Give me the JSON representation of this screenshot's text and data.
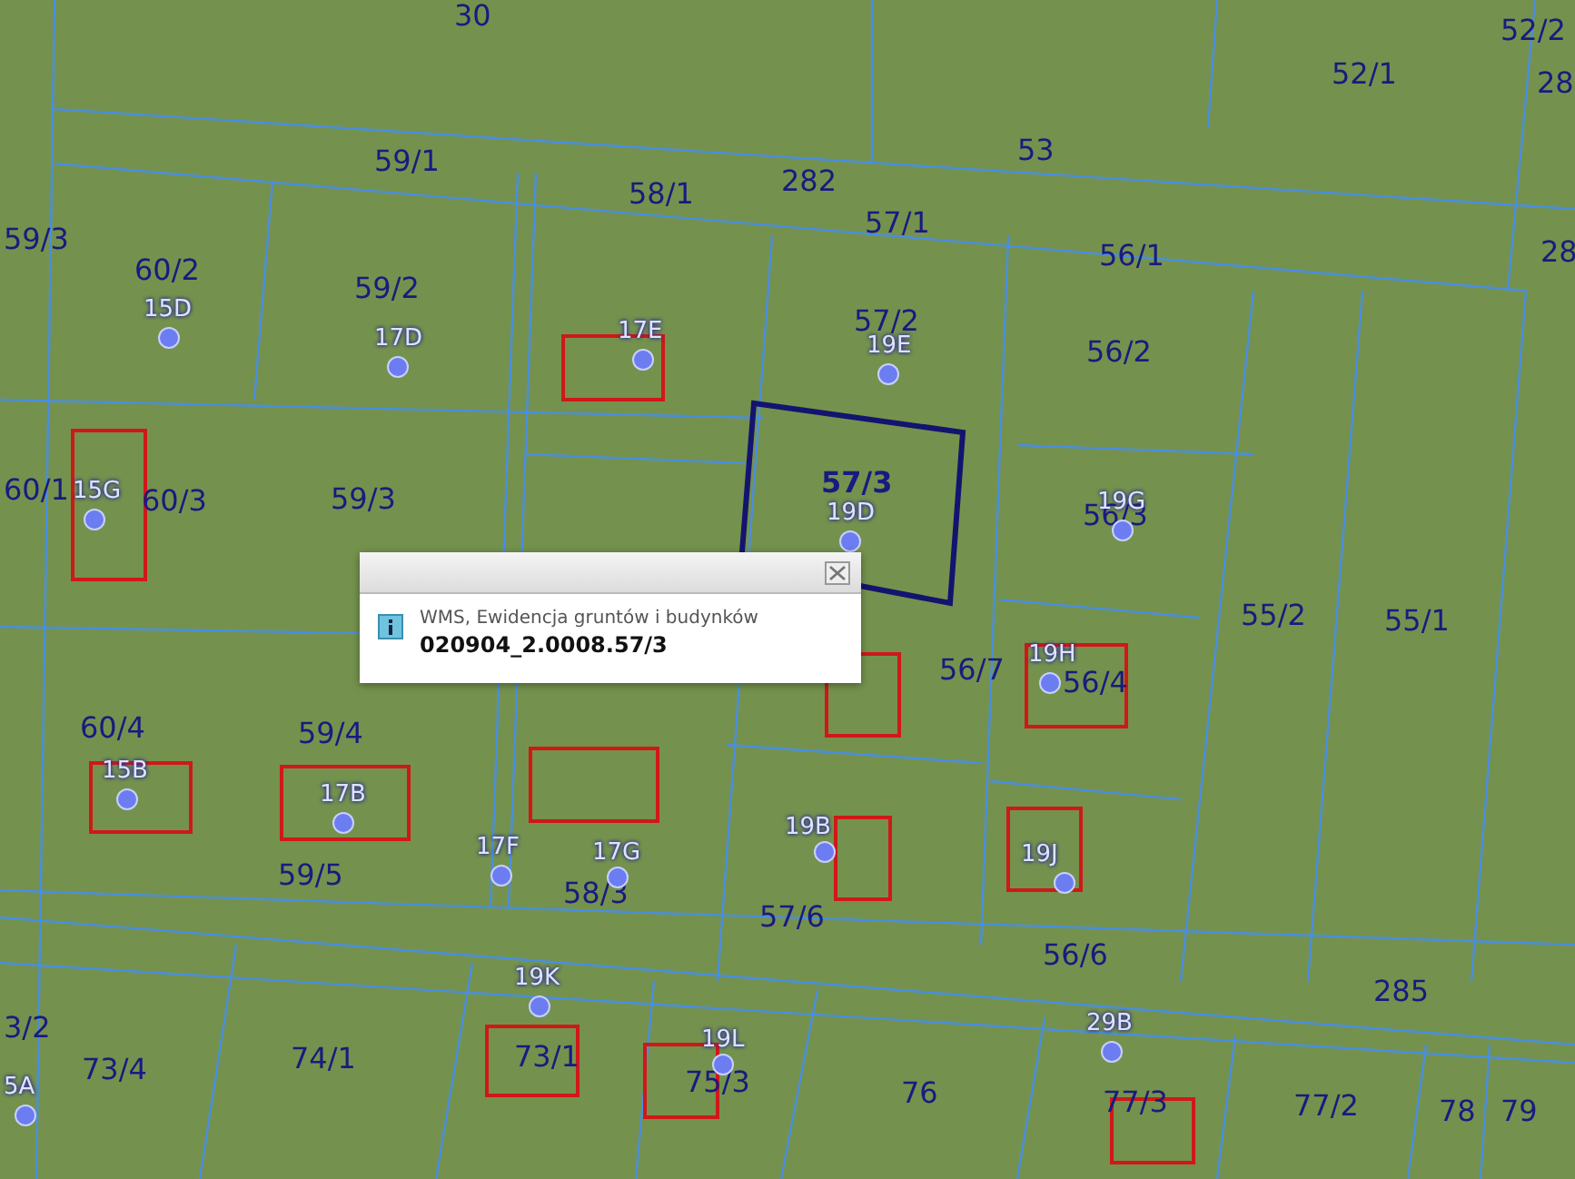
{
  "parcels": [
    {
      "label": "30",
      "selected": false
    },
    {
      "label": "52/2",
      "selected": false
    },
    {
      "label": "52/1",
      "selected": false
    },
    {
      "label": "28",
      "selected": false
    },
    {
      "label": "53",
      "selected": false
    },
    {
      "label": "59/1",
      "selected": false
    },
    {
      "label": "58/1",
      "selected": false
    },
    {
      "label": "282",
      "selected": false
    },
    {
      "label": "57/1",
      "selected": false
    },
    {
      "label": "56/1",
      "selected": false
    },
    {
      "label": "28",
      "selected": false
    },
    {
      "label": "59/3",
      "selected": false
    },
    {
      "label": "60/2",
      "selected": false
    },
    {
      "label": "59/2",
      "selected": false
    },
    {
      "label": "57/2",
      "selected": false
    },
    {
      "label": "56/2",
      "selected": false
    },
    {
      "label": "60/1",
      "selected": false
    },
    {
      "label": "60/3",
      "selected": false
    },
    {
      "label": "59/3",
      "selected": false
    },
    {
      "label": "57/3",
      "selected": true
    },
    {
      "label": "56/3",
      "selected": false
    },
    {
      "label": "55/2",
      "selected": false
    },
    {
      "label": "55/1",
      "selected": false
    },
    {
      "label": "56/7",
      "selected": false
    },
    {
      "label": "56/4",
      "selected": false
    },
    {
      "label": "60/4",
      "selected": false
    },
    {
      "label": "59/4",
      "selected": false
    },
    {
      "label": "59/5",
      "selected": false
    },
    {
      "label": "58/3",
      "selected": false
    },
    {
      "label": "57/6",
      "selected": false
    },
    {
      "label": "56/6",
      "selected": false
    },
    {
      "label": "285",
      "selected": false
    },
    {
      "label": "3/2",
      "selected": false
    },
    {
      "label": "73/4",
      "selected": false
    },
    {
      "label": "74/1",
      "selected": false
    },
    {
      "label": "73/1",
      "selected": false
    },
    {
      "label": "75/3",
      "selected": false
    },
    {
      "label": "76",
      "selected": false
    },
    {
      "label": "77/3",
      "selected": false
    },
    {
      "label": "77/2",
      "selected": false
    },
    {
      "label": "78",
      "selected": false
    },
    {
      "label": "79",
      "selected": false
    }
  ],
  "address_points": [
    {
      "label": "15D"
    },
    {
      "label": "17D"
    },
    {
      "label": "17E"
    },
    {
      "label": "19E"
    },
    {
      "label": "15G"
    },
    {
      "label": "19D"
    },
    {
      "label": "19G"
    },
    {
      "label": "19H"
    },
    {
      "label": "15B"
    },
    {
      "label": "17B"
    },
    {
      "label": "17F"
    },
    {
      "label": "17G"
    },
    {
      "label": "19B"
    },
    {
      "label": "19J"
    },
    {
      "label": "19K"
    },
    {
      "label": "19L"
    },
    {
      "label": "29B"
    },
    {
      "label": "5A"
    }
  ],
  "popup": {
    "source": "WMS, Ewidencja gruntów i budynków",
    "parcel_id": "020904_2.0008.57/3"
  }
}
